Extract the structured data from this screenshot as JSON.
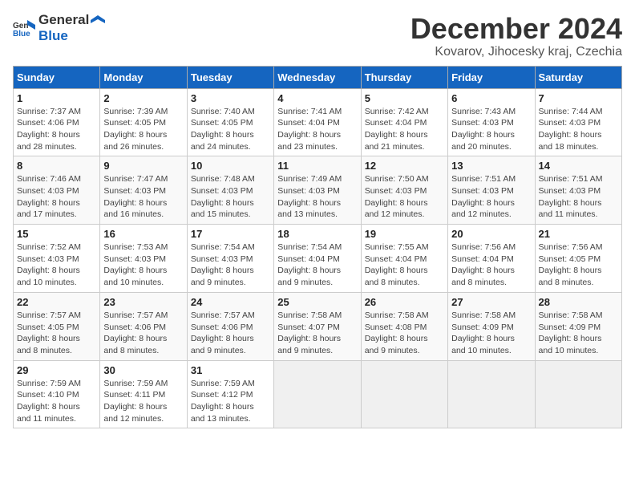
{
  "logo": {
    "general": "General",
    "blue": "Blue"
  },
  "title": "December 2024",
  "subtitle": "Kovarov, Jihocesky kraj, Czechia",
  "days_header": [
    "Sunday",
    "Monday",
    "Tuesday",
    "Wednesday",
    "Thursday",
    "Friday",
    "Saturday"
  ],
  "weeks": [
    [
      {
        "day": "1",
        "info": "Sunrise: 7:37 AM\nSunset: 4:06 PM\nDaylight: 8 hours\nand 28 minutes."
      },
      {
        "day": "2",
        "info": "Sunrise: 7:39 AM\nSunset: 4:05 PM\nDaylight: 8 hours\nand 26 minutes."
      },
      {
        "day": "3",
        "info": "Sunrise: 7:40 AM\nSunset: 4:05 PM\nDaylight: 8 hours\nand 24 minutes."
      },
      {
        "day": "4",
        "info": "Sunrise: 7:41 AM\nSunset: 4:04 PM\nDaylight: 8 hours\nand 23 minutes."
      },
      {
        "day": "5",
        "info": "Sunrise: 7:42 AM\nSunset: 4:04 PM\nDaylight: 8 hours\nand 21 minutes."
      },
      {
        "day": "6",
        "info": "Sunrise: 7:43 AM\nSunset: 4:03 PM\nDaylight: 8 hours\nand 20 minutes."
      },
      {
        "day": "7",
        "info": "Sunrise: 7:44 AM\nSunset: 4:03 PM\nDaylight: 8 hours\nand 18 minutes."
      }
    ],
    [
      {
        "day": "8",
        "info": "Sunrise: 7:46 AM\nSunset: 4:03 PM\nDaylight: 8 hours\nand 17 minutes."
      },
      {
        "day": "9",
        "info": "Sunrise: 7:47 AM\nSunset: 4:03 PM\nDaylight: 8 hours\nand 16 minutes."
      },
      {
        "day": "10",
        "info": "Sunrise: 7:48 AM\nSunset: 4:03 PM\nDaylight: 8 hours\nand 15 minutes."
      },
      {
        "day": "11",
        "info": "Sunrise: 7:49 AM\nSunset: 4:03 PM\nDaylight: 8 hours\nand 13 minutes."
      },
      {
        "day": "12",
        "info": "Sunrise: 7:50 AM\nSunset: 4:03 PM\nDaylight: 8 hours\nand 12 minutes."
      },
      {
        "day": "13",
        "info": "Sunrise: 7:51 AM\nSunset: 4:03 PM\nDaylight: 8 hours\nand 12 minutes."
      },
      {
        "day": "14",
        "info": "Sunrise: 7:51 AM\nSunset: 4:03 PM\nDaylight: 8 hours\nand 11 minutes."
      }
    ],
    [
      {
        "day": "15",
        "info": "Sunrise: 7:52 AM\nSunset: 4:03 PM\nDaylight: 8 hours\nand 10 minutes."
      },
      {
        "day": "16",
        "info": "Sunrise: 7:53 AM\nSunset: 4:03 PM\nDaylight: 8 hours\nand 10 minutes."
      },
      {
        "day": "17",
        "info": "Sunrise: 7:54 AM\nSunset: 4:03 PM\nDaylight: 8 hours\nand 9 minutes."
      },
      {
        "day": "18",
        "info": "Sunrise: 7:54 AM\nSunset: 4:04 PM\nDaylight: 8 hours\nand 9 minutes."
      },
      {
        "day": "19",
        "info": "Sunrise: 7:55 AM\nSunset: 4:04 PM\nDaylight: 8 hours\nand 8 minutes."
      },
      {
        "day": "20",
        "info": "Sunrise: 7:56 AM\nSunset: 4:04 PM\nDaylight: 8 hours\nand 8 minutes."
      },
      {
        "day": "21",
        "info": "Sunrise: 7:56 AM\nSunset: 4:05 PM\nDaylight: 8 hours\nand 8 minutes."
      }
    ],
    [
      {
        "day": "22",
        "info": "Sunrise: 7:57 AM\nSunset: 4:05 PM\nDaylight: 8 hours\nand 8 minutes."
      },
      {
        "day": "23",
        "info": "Sunrise: 7:57 AM\nSunset: 4:06 PM\nDaylight: 8 hours\nand 8 minutes."
      },
      {
        "day": "24",
        "info": "Sunrise: 7:57 AM\nSunset: 4:06 PM\nDaylight: 8 hours\nand 9 minutes."
      },
      {
        "day": "25",
        "info": "Sunrise: 7:58 AM\nSunset: 4:07 PM\nDaylight: 8 hours\nand 9 minutes."
      },
      {
        "day": "26",
        "info": "Sunrise: 7:58 AM\nSunset: 4:08 PM\nDaylight: 8 hours\nand 9 minutes."
      },
      {
        "day": "27",
        "info": "Sunrise: 7:58 AM\nSunset: 4:09 PM\nDaylight: 8 hours\nand 10 minutes."
      },
      {
        "day": "28",
        "info": "Sunrise: 7:58 AM\nSunset: 4:09 PM\nDaylight: 8 hours\nand 10 minutes."
      }
    ],
    [
      {
        "day": "29",
        "info": "Sunrise: 7:59 AM\nSunset: 4:10 PM\nDaylight: 8 hours\nand 11 minutes."
      },
      {
        "day": "30",
        "info": "Sunrise: 7:59 AM\nSunset: 4:11 PM\nDaylight: 8 hours\nand 12 minutes."
      },
      {
        "day": "31",
        "info": "Sunrise: 7:59 AM\nSunset: 4:12 PM\nDaylight: 8 hours\nand 13 minutes."
      },
      null,
      null,
      null,
      null
    ]
  ]
}
